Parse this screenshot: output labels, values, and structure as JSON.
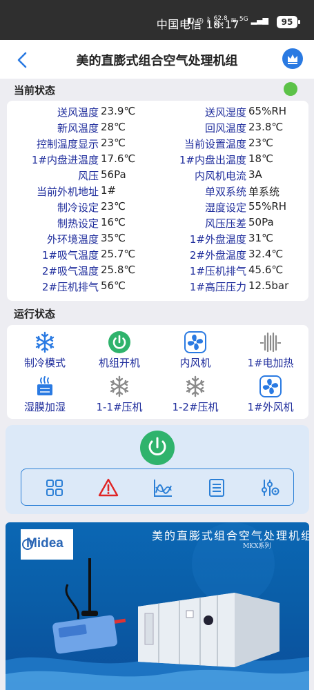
{
  "status_bar": {
    "carrier_time": "中国电信 18:17",
    "net_speed_value": "62.8",
    "net_speed_unit": "K/s",
    "signal": "5G",
    "battery": "95"
  },
  "header": {
    "title": "美的直膨式组合空气处理机组"
  },
  "current_status": {
    "title": "当前状态",
    "indicator_color": "#5cc248",
    "rows": [
      {
        "label_left": "送风温度",
        "value_left": "23.9℃",
        "label_right": "送风湿度",
        "value_right": "65%RH"
      },
      {
        "label_left": "新风温度",
        "value_left": "28℃",
        "label_right": "回风温度",
        "value_right": "23.8℃"
      },
      {
        "label_left": "控制温度显示",
        "value_left": "23℃",
        "label_right": "当前设置温度",
        "value_right": "23℃"
      },
      {
        "label_left": "1#内盘进温度",
        "value_left": "17.6℃",
        "label_right": "1#内盘出温度",
        "value_right": "18℃"
      },
      {
        "label_left": "风压",
        "value_left": "56Pa",
        "label_right": "内风机电流",
        "value_right": "3A"
      },
      {
        "label_left": "当前外机地址",
        "value_left": "1#",
        "label_right": "单双系统",
        "value_right": "单系统"
      },
      {
        "label_left": "制冷设定",
        "value_left": "23℃",
        "label_right": "湿度设定",
        "value_right": "55%RH"
      },
      {
        "label_left": "制热设定",
        "value_left": "16℃",
        "label_right": "风压压差",
        "value_right": "50Pa"
      },
      {
        "label_left": "外环境温度",
        "value_left": "35℃",
        "label_right": "1#外盘温度",
        "value_right": "31℃"
      },
      {
        "label_left": "1#吸气温度",
        "value_left": "25.7℃",
        "label_right": "2#外盘温度",
        "value_right": "32.4℃"
      },
      {
        "label_left": "2#吸气温度",
        "value_left": "25.8℃",
        "label_right": "1#压机排气",
        "value_right": "45.6℃"
      },
      {
        "label_left": "2#压机排气",
        "value_left": "56℃",
        "label_right": "1#高压压力",
        "value_right": "12.5bar"
      }
    ]
  },
  "run_status": {
    "title": "运行状态",
    "items": [
      {
        "label": "制冷模式",
        "icon": "snowflake-icon",
        "active": true
      },
      {
        "label": "机组开机",
        "icon": "power-icon",
        "active": true
      },
      {
        "label": "内风机",
        "icon": "fan-icon",
        "active": true
      },
      {
        "label": "1#电加热",
        "icon": "heater-icon",
        "active": false
      },
      {
        "label": "湿膜加湿",
        "icon": "humidifier-icon",
        "active": true
      },
      {
        "label": "1-1#压机",
        "icon": "snowflake-icon",
        "active": false
      },
      {
        "label": "1-2#压机",
        "icon": "snowflake-icon",
        "active": false
      },
      {
        "label": "1#外风机",
        "icon": "fan-icon",
        "active": true
      }
    ]
  },
  "controls": {
    "power_color": "#2fb36c",
    "toolbar": [
      "grid-icon",
      "alarm-icon",
      "chart-icon",
      "list-icon",
      "settings-icon"
    ]
  },
  "banner": {
    "title": "美的直膨式组合空气处理机组",
    "subtitle": "MKX系列",
    "logo": "Midea"
  },
  "colors": {
    "accent": "#2a7ae2",
    "label_blue": "#1f2d9c",
    "active_green": "#2fb36c"
  }
}
